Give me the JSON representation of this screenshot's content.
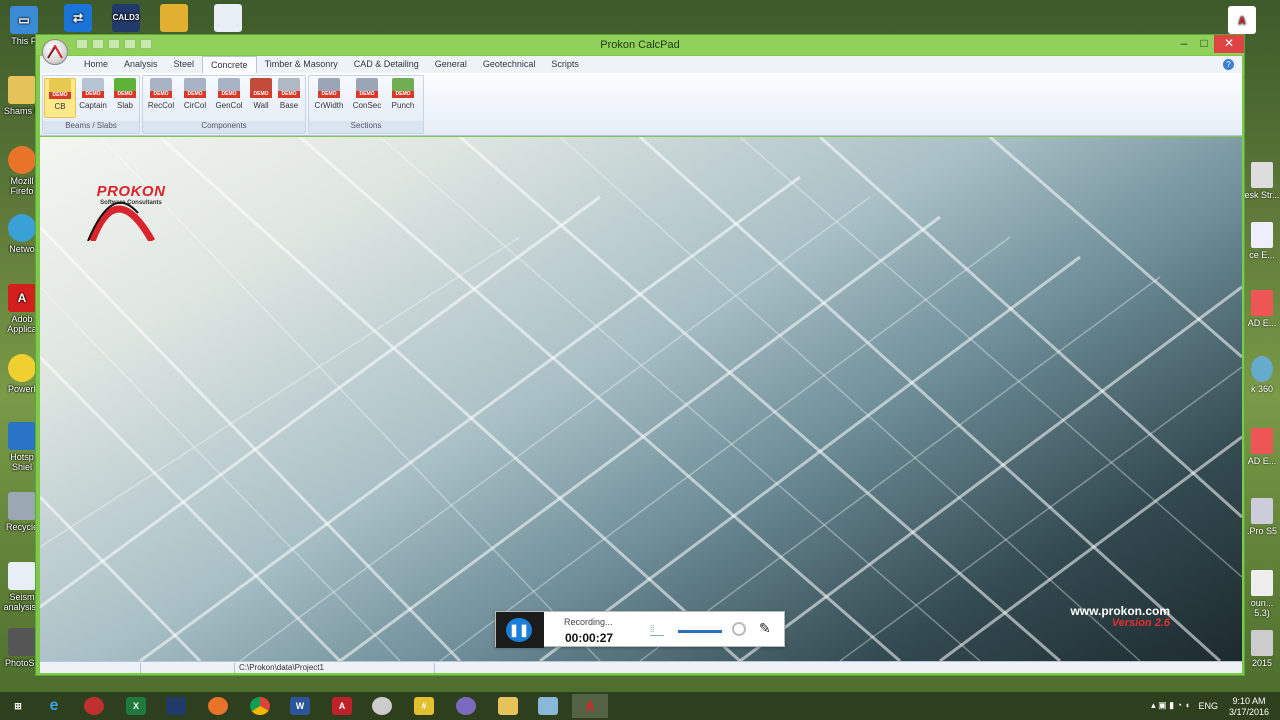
{
  "window": {
    "title": "Prokon CalcPad",
    "tabs": [
      "Home",
      "Analysis",
      "Steel",
      "Concrete",
      "Timber & Masonry",
      "CAD & Detailing",
      "General",
      "Geotechnical",
      "Scripts"
    ],
    "active_tab": "Concrete",
    "help": "?"
  },
  "ribbon": {
    "badge": "DEMO",
    "groups": {
      "beams": {
        "label": "Beams / Slabs",
        "items": [
          "CB",
          "Captain",
          "Slab"
        ]
      },
      "components": {
        "label": "Components",
        "items": [
          "RecCol",
          "CirCol",
          "GenCol",
          "Wall",
          "Base"
        ]
      },
      "sections": {
        "label": "Sections",
        "items": [
          "CrWidth",
          "ConSec",
          "Punch"
        ]
      }
    }
  },
  "content": {
    "logo_brand": "PROKON",
    "logo_sub": "Software Consultants",
    "website": "www.prokon.com",
    "version": "Version 2.6"
  },
  "statusbar": {
    "path": "C:\\Prokon\\data\\Project1"
  },
  "recorder": {
    "status": "Recording...",
    "time": "00:00:27"
  },
  "desktop": {
    "left_icons": [
      "This P",
      "Shams F",
      "Mozill Firefo",
      "Netwo",
      "Adob Applica",
      "PowerI",
      "Hotsp Shiel",
      "Recycle",
      "Seism analysis i",
      "PhotoSc"
    ],
    "top_icons": [
      "CALD3"
    ],
    "right_labels": [
      "esk Str...",
      "ce E...",
      "AD E...",
      "k 360",
      "AD E...",
      ".Pro S5",
      "oun... 5.3)",
      "2015"
    ]
  },
  "taskbar": {
    "lang": "ENG",
    "time": "9:10 AM",
    "date": "3/17/2016"
  }
}
